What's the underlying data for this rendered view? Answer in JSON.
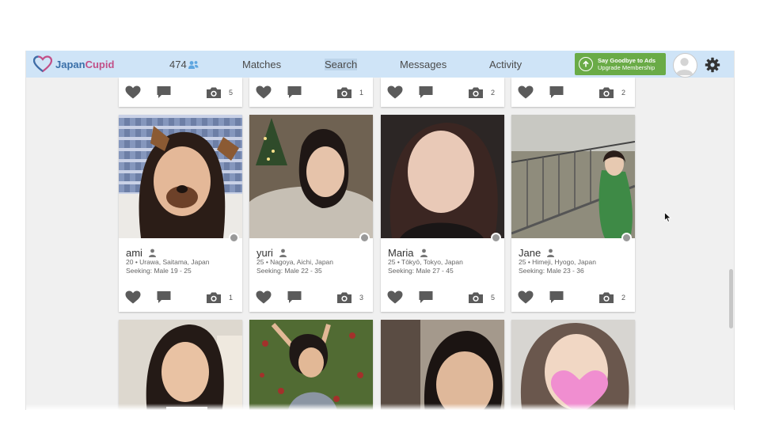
{
  "app": {
    "logo_part1": "Japan",
    "logo_part2": "Cupid"
  },
  "nav": {
    "online_count": "474",
    "items": [
      {
        "label": "Matches",
        "active": false
      },
      {
        "label": "Search",
        "active": true
      },
      {
        "label": "Messages",
        "active": false
      },
      {
        "label": "Activity",
        "active": false
      }
    ]
  },
  "upgrade": {
    "line1": "Say Goodbye to Ads",
    "line2": "Upgrade Membership"
  },
  "top_row_photo_counts": [
    "5",
    "1",
    "2",
    "2"
  ],
  "profiles": [
    {
      "name": "ami",
      "location": "20 • Urawa, Saitama, Japan",
      "seeking": "Seeking: Male 19 - 25",
      "photos": "1"
    },
    {
      "name": "yuri",
      "location": "25 • Nagoya, Aichi, Japan",
      "seeking": "Seeking: Male 22 - 35",
      "photos": "3"
    },
    {
      "name": "Maria",
      "location": "25 • Tōkyō, Tokyo, Japan",
      "seeking": "Seeking: Male 27 - 45",
      "photos": "5"
    },
    {
      "name": "Jane",
      "location": "25 • Himeji, Hyogo, Japan",
      "seeking": "Seeking: Male 23 - 36",
      "photos": "2"
    }
  ],
  "colors": {
    "nav_bg": "#cfe4f7",
    "upgrade_green": "#6aab47",
    "icon_gray": "#5b5b5b",
    "logo_blue": "#3a6fa8",
    "logo_pink": "#c24f87"
  },
  "icons": [
    "heart-icon",
    "comment-icon",
    "camera-icon",
    "person-icon",
    "gear-icon",
    "upload-arrow-icon"
  ]
}
